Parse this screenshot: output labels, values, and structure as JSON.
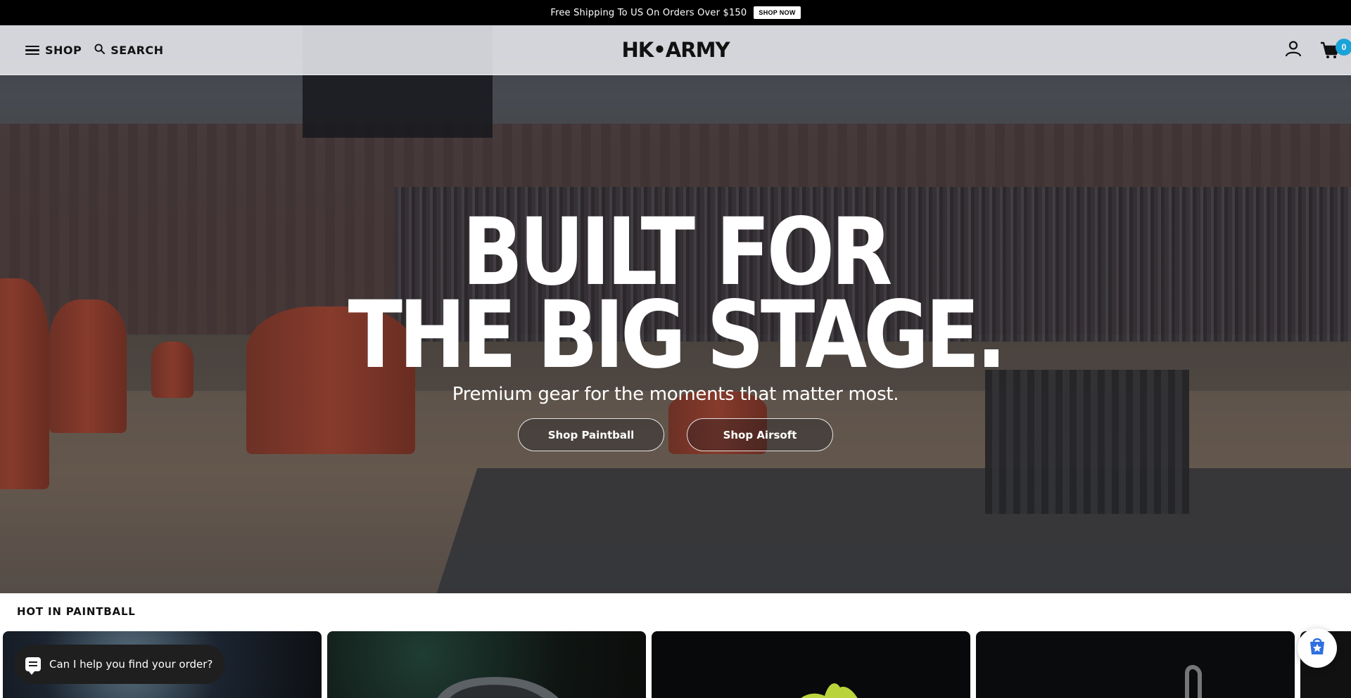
{
  "announcement": {
    "text": "Free Shipping To US On Orders Over $150",
    "button_label": "SHOP NOW"
  },
  "header": {
    "menu_label": "SHOP",
    "search_label": "SEARCH",
    "logo_text": "HK•ARMY",
    "account_icon": "user-icon",
    "cart_icon": "cart-icon",
    "cart_count": "0",
    "cart_badge_color": "#1aa3d8"
  },
  "hero": {
    "headline_line1": "BUILT FOR",
    "headline_line2": "THE BIG STAGE.",
    "subheadline": "Premium gear for the moments that matter most.",
    "cta_primary": "Shop Paintball",
    "cta_secondary": "Shop Airsoft"
  },
  "section": {
    "title": "HOT IN PAINTBALL"
  },
  "chat": {
    "prompt": "Can I help you find your order?",
    "icon": "chat-icon"
  },
  "rewards": {
    "icon": "rewards-star-icon"
  }
}
